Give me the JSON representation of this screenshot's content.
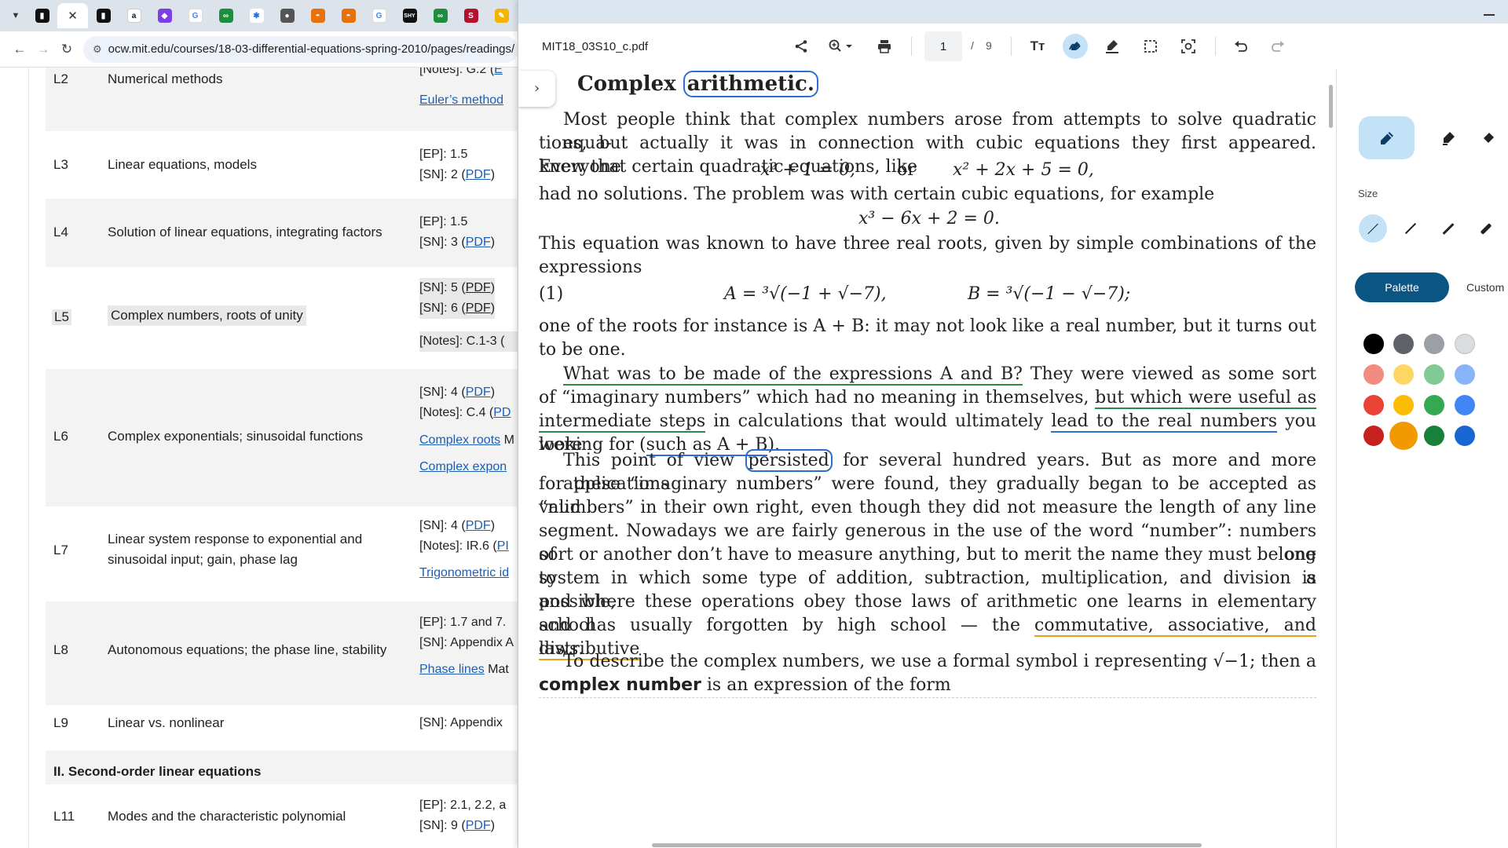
{
  "browser": {
    "url": "ocw.mit.edu/courses/18-03-differential-equations-spring-2010/pages/readings/"
  },
  "webpage": {
    "rows": [
      {
        "code": "L2",
        "title": "Numerical methods",
        "refs": [
          "[Notes]: G.2 (",
          "Euler’s method"
        ]
      },
      {
        "code": "L3",
        "title": "Linear equations, models",
        "refs": [
          "[EP]: 1.5",
          "[SN]: 2 (",
          "PDF",
          ")"
        ]
      },
      {
        "code": "L4",
        "title": "Solution of linear equations, integrating factors",
        "refs": [
          "[EP]: 1.5",
          "[SN]: 3 (",
          "PDF",
          ")"
        ]
      },
      {
        "code": "L5",
        "title": "Complex numbers, roots of unity",
        "refs": [
          "[SN]: 5 (",
          "PDF",
          ")",
          "[SN]: 6 (",
          "PDF",
          ")",
          "[Notes]: C.1-3 ("
        ]
      },
      {
        "code": "L6",
        "title": "Complex exponentials; sinusoidal functions",
        "refs": [
          "[SN]: 4 (",
          "PDF",
          ")",
          "[Notes]: C.4 (",
          "PD",
          "Complex roots",
          "Complex expon"
        ]
      },
      {
        "code": "L7",
        "title": "Linear system response to exponential and sinusoidal input; gain, phase lag",
        "refs": [
          "[SN]: 4 (",
          "PDF",
          ")",
          "[Notes]: IR.6 (",
          "PI",
          "Trigonometric id"
        ]
      },
      {
        "code": "L8",
        "title": "Autonomous equations; the phase line, stability",
        "refs": [
          "[EP]: 1.7 and 7.",
          "[SN]: Appendix A",
          "Phase lines",
          "Mat"
        ]
      },
      {
        "code": "L9",
        "title": "Linear vs. nonlinear",
        "refs": [
          "[SN]: Appendix"
        ]
      },
      {
        "code": "L11",
        "title": "Modes and the characteristic polynomial",
        "refs": [
          "[EP]: 2.1, 2.2, a",
          "[SN]: 9 (",
          "PDF",
          ")"
        ]
      }
    ],
    "section": "II. Second-order linear equations"
  },
  "pdf": {
    "filename": "MIT18_03S10_c.pdf",
    "page_current": "1",
    "page_sep": "/",
    "page_total": "9",
    "toolbar_icons": [
      "share-icon",
      "zoom-icon",
      "print-icon",
      "text-icon",
      "draw-icon",
      "highlight-icon",
      "select-area-icon",
      "find-icon",
      "undo-icon",
      "redo-icon"
    ],
    "title_a": "Complex",
    "title_b": "arithmetic.",
    "p1": [
      "Most people think that complex numbers arose from attempts to solve quadratic equa-",
      "tions, but actually it was in connection with cubic equations they first appeared. Everyone",
      "knew that certain quadratic equations, like"
    ],
    "eq1a": "x² + 1 = 0,",
    "eq1or": "or",
    "eq1b": "x² + 2x + 5 = 0,",
    "p2": "had no solutions. The problem was with certain cubic equations, for example",
    "eq2": "x³ − 6x + 2 = 0.",
    "p3": [
      "This equation was known to have three real roots, given by simple combinations of the",
      "expressions"
    ],
    "eqnum": "(1)",
    "eqA": "A = ³√(−1 + √−7),",
    "eqB": "B = ³√(−1 − √−7);",
    "p4": [
      "one of the roots for instance is  A + B: it may not look like a real number, but it turns out",
      "to be one."
    ],
    "p5": {
      "l1a": "What was to be made of the expressions A and B?",
      "l1b": " They were viewed as some sort",
      "l2a": "of “imaginary numbers” which had no meaning in themselves, ",
      "l2b": "but which were useful as",
      "l3a": "intermediate steps",
      "l3b": " in calculations that would ultimately ",
      "l3c": "lead to the real numbers",
      "l3d": " you were",
      "l4a": "looking for (",
      "l4b": "such as A + B",
      "l4c": ")."
    },
    "p6": {
      "l1a": "This point of view ",
      "l1b": "persisted",
      "l1c": " for several hundred years. But as more and more applications",
      "lines": [
        "for these “imaginary numbers” were found, they gradually began to be accepted as valid",
        "“numbers” in their own right, even though they did not measure the length of any line",
        "segment. Nowadays we are fairly generous in the use of the word “number”: numbers of one",
        "sort or another don’t have to measure anything, but to merit the name they must belong to a",
        "system in which some type of addition, subtraction, multiplication, and division is possible,",
        "and where these operations obey those laws of arithmetic one learns in elementary school"
      ],
      "l8a": "and has usually forgotten by high school — the ",
      "l8b": "commutative, associative, and distributive",
      "l9": "laws."
    },
    "p7": {
      "l1": "To describe the complex numbers, we use a formal symbol i representing √−1; then a",
      "l2a": "complex number",
      "l2b": " is an expression of the form"
    }
  },
  "annotate": {
    "tools": [
      "pen-icon",
      "highlighter-icon",
      "eraser-icon"
    ],
    "size_label": "Size",
    "tab_palette": "Palette",
    "tab_custom": "Custom",
    "colors": [
      [
        "#000000",
        "#5f6368",
        "#9aa0a6",
        "#dadce0"
      ],
      [
        "#f28b82",
        "#fdd663",
        "#81c995",
        "#8ab4f8"
      ],
      [
        "#ea4335",
        "#fbbc04",
        "#34a853",
        "#4285f4"
      ],
      [
        "#c5221f",
        "#f29900",
        "#188038",
        "#1967d2"
      ]
    ],
    "selected_color": "#f29900"
  }
}
